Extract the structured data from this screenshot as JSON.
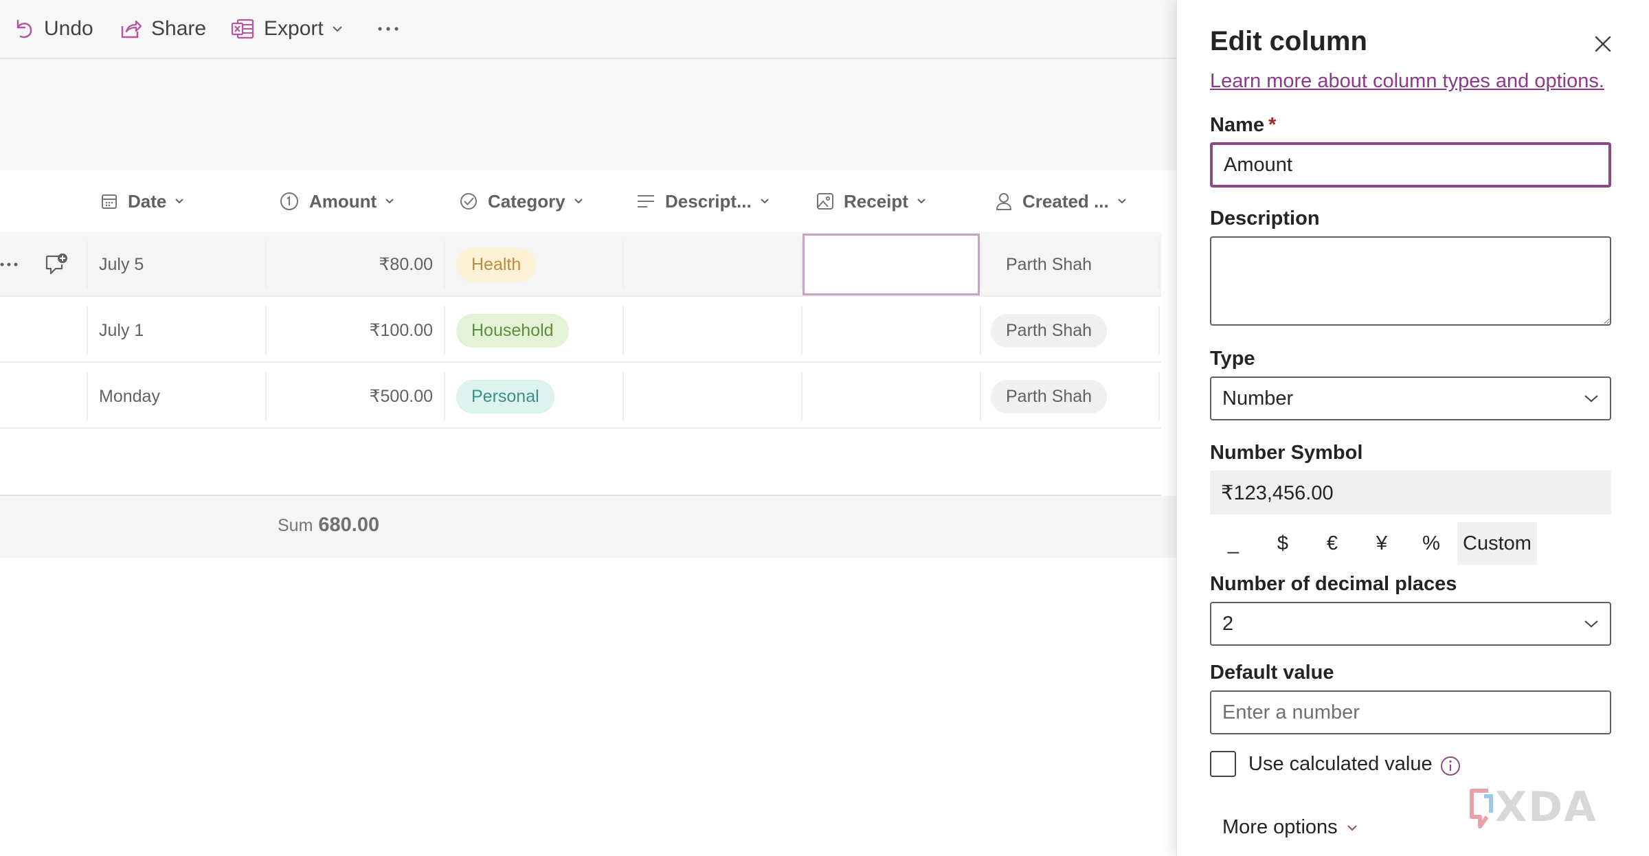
{
  "colors": {
    "accent": "#8a4a87",
    "link": "#8a3a88",
    "health_pill_bg": "#fdf1d6",
    "household_pill_bg": "#e4f2d8",
    "personal_pill_bg": "#dcf3ef"
  },
  "toolbar": {
    "undo_label": "Undo",
    "share_label": "Share",
    "export_label": "Export",
    "more_icon": "more-horizontal-icon"
  },
  "columns": [
    {
      "label": "Date",
      "icon": "calendar-icon"
    },
    {
      "label": "Amount",
      "icon": "number-icon"
    },
    {
      "label": "Category",
      "icon": "choice-check-icon"
    },
    {
      "label": "Descript...",
      "icon": "text-lines-icon"
    },
    {
      "label": "Receipt",
      "icon": "image-icon"
    },
    {
      "label": "Created ...",
      "icon": "person-icon"
    }
  ],
  "rows": [
    {
      "date": "July 5",
      "amount": "₹80.00",
      "category": "Health",
      "created_by": "Parth Shah"
    },
    {
      "date": "July 1",
      "amount": "₹100.00",
      "category": "Household",
      "created_by": "Parth Shah"
    },
    {
      "date": "Monday",
      "amount": "₹500.00",
      "category": "Personal",
      "created_by": "Parth Shah"
    }
  ],
  "footer": {
    "sum_label": "Sum",
    "sum_value": "680.00"
  },
  "panel": {
    "title": "Edit column",
    "learn_link": "Learn more about column types and options.",
    "name_label": "Name",
    "required_marker": "*",
    "name_value": "Amount",
    "description_label": "Description",
    "description_value": "",
    "type_label": "Type",
    "type_value": "Number",
    "symbol_label": "Number Symbol",
    "symbol_preview": "₹123,456.00",
    "symbol_options": [
      "_",
      "$",
      "€",
      "¥",
      "%",
      "Custom"
    ],
    "symbol_selected": "Custom",
    "decimal_label": "Number of decimal places",
    "decimal_value": "2",
    "default_label": "Default value",
    "default_placeholder": "Enter a number",
    "calc_label": "Use calculated value",
    "calc_checked": false,
    "more_options": "More options"
  },
  "watermark": "XDA"
}
